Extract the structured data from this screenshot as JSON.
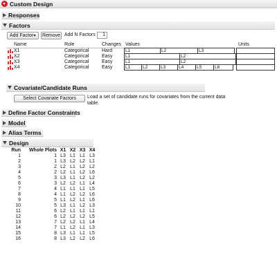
{
  "title": "Custom Design",
  "sections": {
    "responses": "Responses",
    "factors": "Factors",
    "covariate": "Covariate/Candidate Runs",
    "constraints": "Define Factor Constraints",
    "model": "Model",
    "alias": "Alias Terms",
    "design": "Design"
  },
  "factors_toolbar": {
    "add_factor": "Add Factor",
    "remove": "Remove",
    "add_n_label": "Add N Factors",
    "add_n_value": "1"
  },
  "factor_columns": {
    "name": "Name",
    "role": "Role",
    "changes": "Changes",
    "values": "Values",
    "units": "Units"
  },
  "factors": [
    {
      "name": "X1",
      "role": "Categorical",
      "changes": "Hard",
      "values": [
        "L1",
        "L2",
        "L3"
      ]
    },
    {
      "name": "X2",
      "role": "Categorical",
      "changes": "Easy",
      "values": [
        "L1",
        "L2"
      ]
    },
    {
      "name": "X3",
      "role": "Categorical",
      "changes": "Easy",
      "values": [
        "L1",
        "L2"
      ]
    },
    {
      "name": "X4",
      "role": "Categorical",
      "changes": "Easy",
      "values": [
        "L1",
        "L2",
        "L3",
        "L4",
        "L5",
        "L6"
      ]
    }
  ],
  "covariate": {
    "button": "Select Covariate Factors",
    "description_line1": "Load a set of candidate runs for covariates from the current data",
    "description_line2": "table."
  },
  "design": {
    "columns": [
      "Run",
      "Whole Plots",
      "X1",
      "X2",
      "X3",
      "X4"
    ],
    "rows": [
      [
        "1",
        "1",
        "L3",
        "L1",
        "L1",
        "L3"
      ],
      [
        "2",
        "1",
        "L3",
        "L2",
        "L2",
        "L1"
      ],
      [
        "3",
        "2",
        "L2",
        "L1",
        "L2",
        "L2"
      ],
      [
        "4",
        "2",
        "L2",
        "L1",
        "L2",
        "L6"
      ],
      [
        "5",
        "3",
        "L3",
        "L1",
        "L2",
        "L2"
      ],
      [
        "6",
        "3",
        "L2",
        "L2",
        "L1",
        "L4"
      ],
      [
        "7",
        "4",
        "L1",
        "L1",
        "L1",
        "L5"
      ],
      [
        "8",
        "4",
        "L1",
        "L2",
        "L2",
        "L6"
      ],
      [
        "9",
        "5",
        "L1",
        "L2",
        "L1",
        "L6"
      ],
      [
        "10",
        "5",
        "L3",
        "L1",
        "L2",
        "L3"
      ],
      [
        "11",
        "6",
        "L2",
        "L1",
        "L1",
        "L1"
      ],
      [
        "12",
        "6",
        "L2",
        "L2",
        "L2",
        "L5"
      ],
      [
        "13",
        "7",
        "L2",
        "L2",
        "L1",
        "L4"
      ],
      [
        "14",
        "7",
        "L1",
        "L2",
        "L1",
        "L3"
      ],
      [
        "15",
        "8",
        "L3",
        "L1",
        "L1",
        "L5"
      ],
      [
        "16",
        "8",
        "L3",
        "L2",
        "L2",
        "L6"
      ]
    ]
  }
}
